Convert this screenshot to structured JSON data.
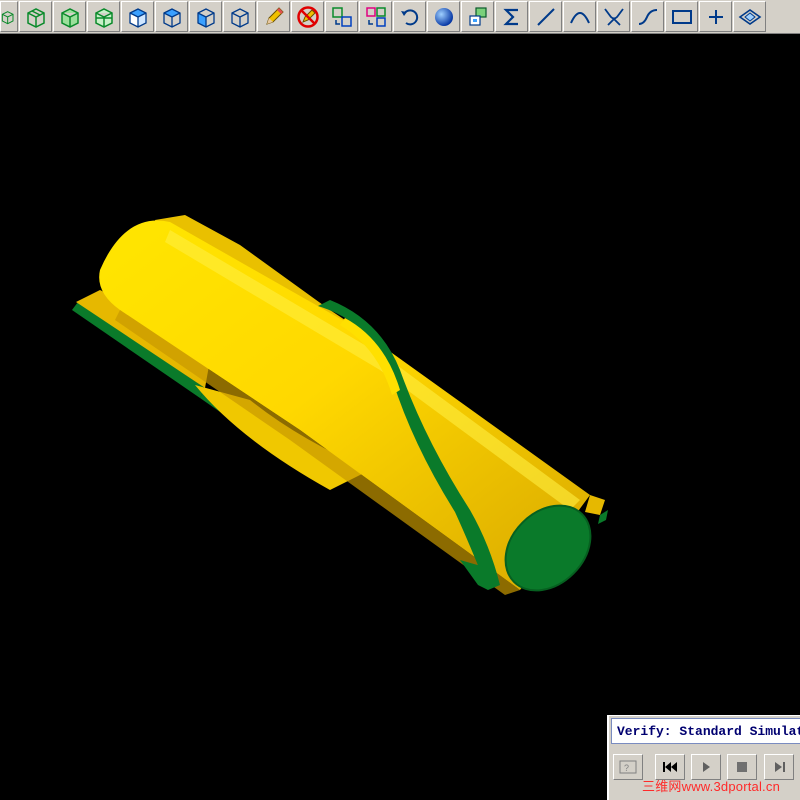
{
  "toolbar": {
    "buttons": [
      {
        "icon": "wireframe-cube-icon"
      },
      {
        "icon": "wireframe-cube-icon"
      },
      {
        "icon": "hidden-line-cube-icon"
      },
      {
        "icon": "shaded-cube-icon"
      },
      {
        "icon": "iso-view-cube-icon"
      },
      {
        "icon": "top-view-cube-icon"
      },
      {
        "icon": "front-view-cube-icon"
      },
      {
        "icon": "side-view-cube-icon"
      },
      {
        "icon": "pencil-icon"
      },
      {
        "icon": "no-draw-icon"
      },
      {
        "icon": "translate-icon"
      },
      {
        "icon": "copy-translate-icon"
      },
      {
        "icon": "rotate-icon"
      },
      {
        "icon": "sphere-icon"
      },
      {
        "icon": "group-icon"
      },
      {
        "icon": "sigma-icon"
      },
      {
        "icon": "line-icon"
      },
      {
        "icon": "arc-icon"
      },
      {
        "icon": "fillet-icon"
      },
      {
        "icon": "spline-icon"
      },
      {
        "icon": "rectangle-icon"
      },
      {
        "icon": "point-plus-icon"
      },
      {
        "icon": "plane-icon"
      }
    ]
  },
  "colors": {
    "model_yellow": "#ffd800",
    "model_shadow": "#c8a000",
    "model_green": "#0a7a2a",
    "title_text": "#000070",
    "watermark": "#ff2a2a"
  },
  "verify_panel": {
    "title": "Verify: Standard Simulation",
    "buttons": [
      {
        "icon": "help-icon"
      },
      {
        "icon": "rewind-icon"
      },
      {
        "icon": "play-icon"
      },
      {
        "icon": "stop-icon"
      },
      {
        "icon": "step-forward-icon"
      }
    ]
  },
  "watermark": {
    "text": "三维网www.3dportal.cn"
  }
}
